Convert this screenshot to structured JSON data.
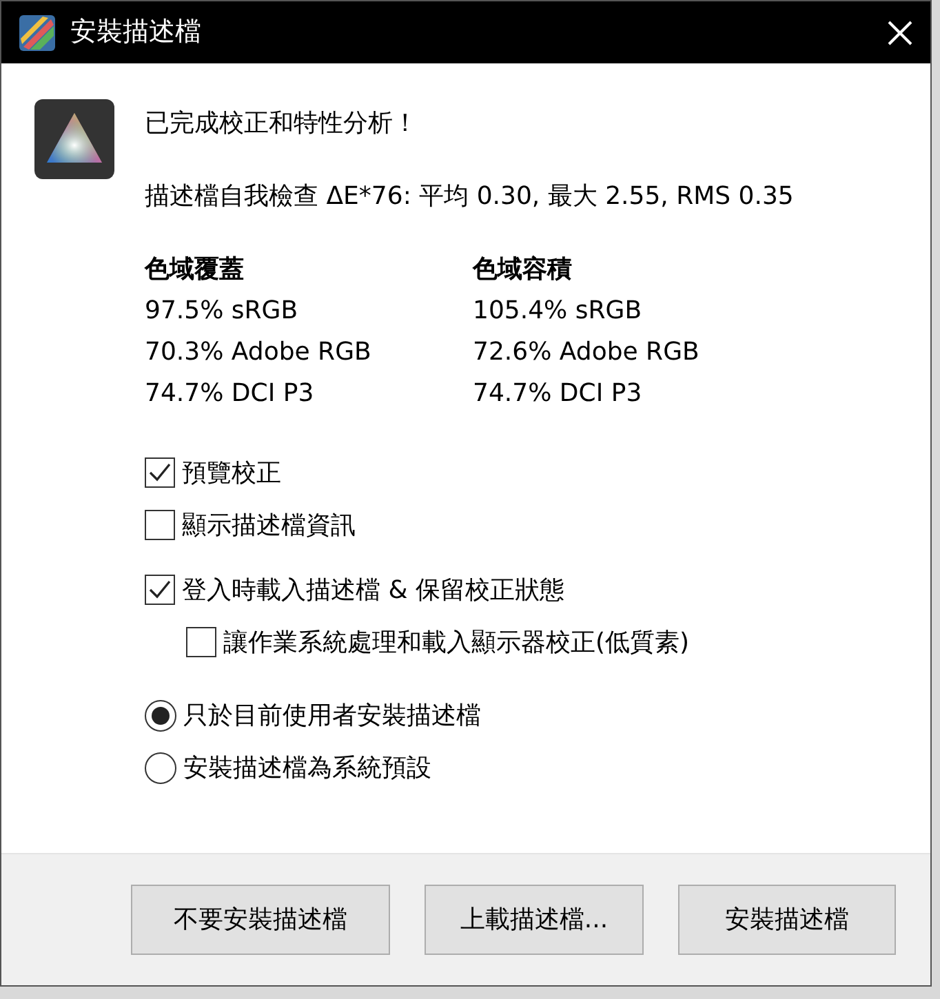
{
  "window": {
    "title": "安裝描述檔"
  },
  "heading": "已完成校正和特性分析！",
  "self_check": "描述檔自我檢查 ΔE*76: 平均 0.30, 最大 2.55, RMS 0.35",
  "gamut_columns": [
    {
      "title": "色域覆蓋",
      "values": [
        "97.5% sRGB",
        "70.3% Adobe RGB",
        "74.7% DCI P3"
      ]
    },
    {
      "title": "色域容積",
      "values": [
        "105.4% sRGB",
        "72.6% Adobe RGB",
        "74.7% DCI P3"
      ]
    }
  ],
  "checkbox_groups": [
    [
      {
        "label": "預覽校正",
        "checked": true,
        "indented": false
      },
      {
        "label": "顯示描述檔資訊",
        "checked": false,
        "indented": false
      }
    ],
    [
      {
        "label": "登入時載入描述檔 & 保留校正狀態",
        "checked": true,
        "indented": false
      },
      {
        "label": "讓作業系統處理和載入顯示器校正(低質素)",
        "checked": false,
        "indented": true
      }
    ]
  ],
  "install_scope": [
    {
      "label": "只於目前使用者安裝描述檔",
      "selected": true
    },
    {
      "label": "安裝描述檔為系統預設",
      "selected": false
    }
  ],
  "buttons": [
    "不要安裝描述檔",
    "上載描述檔...",
    "安裝描述檔"
  ]
}
